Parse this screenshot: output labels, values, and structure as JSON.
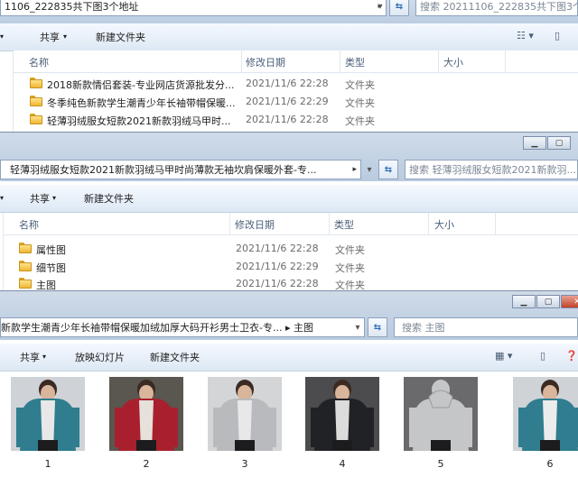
{
  "colors": {
    "accent": "#1e57a4",
    "folder": "#f0b735",
    "titlebar": "#c4d4e7"
  },
  "win1": {
    "address": "1106_222835共下图3个地址",
    "search_placeholder": "搜索 20211106_222835共下图3个地址",
    "toolbar": {
      "share": "共享",
      "new_folder": "新建文件夹"
    },
    "columns": [
      "名称",
      "修改日期",
      "类型",
      "大小"
    ],
    "rows": [
      {
        "name": "2018新款情侣套装-专业网店货源批发分...",
        "date": "2021/11/6 22:28",
        "type": "文件夹"
      },
      {
        "name": "冬季纯色新款学生潮青少年长袖带帽保暖...",
        "date": "2021/11/6 22:29",
        "type": "文件夹"
      },
      {
        "name": "轻薄羽绒服女短款2021新款羽绒马甲时...",
        "date": "2021/11/6 22:28",
        "type": "文件夹"
      }
    ]
  },
  "win2": {
    "address": "轻薄羽绒服女短款2021新款羽绒马甲时尚薄款无袖坎肩保暖外套-专...",
    "search_placeholder": "搜索 轻薄羽绒服女短款2021新款羽...",
    "toolbar": {
      "share": "共享",
      "new_folder": "新建文件夹"
    },
    "columns": [
      "名称",
      "修改日期",
      "类型",
      "大小"
    ],
    "rows": [
      {
        "name": "属性图",
        "date": "2021/11/6 22:28",
        "type": "文件夹"
      },
      {
        "name": "细节图",
        "date": "2021/11/6 22:29",
        "type": "文件夹"
      },
      {
        "name": "主图",
        "date": "2021/11/6 22:28",
        "type": "文件夹"
      }
    ]
  },
  "win3": {
    "address": "新款学生潮青少年长袖带帽保暖加绒加厚大码开衫男士卫衣-专...  ▸  主图",
    "search_placeholder": "搜索 主图",
    "toolbar": {
      "share": "共享",
      "slideshow": "放映幻灯片",
      "new_folder": "新建文件夹"
    },
    "thumbnails": [
      {
        "label": "1",
        "jacket": "#2f7d8f",
        "shirt": "#e8e8e8",
        "bg": "#cfd2d6"
      },
      {
        "label": "2",
        "jacket": "#a8202e",
        "shirt": "#e6e1da",
        "bg": "#5a5650"
      },
      {
        "label": "3",
        "jacket": "#b9babd",
        "shirt": "#e8e8e8",
        "bg": "#d4d5d7"
      },
      {
        "label": "4",
        "jacket": "#202226",
        "shirt": "#dcdcdc",
        "bg": "#4c4c4e"
      },
      {
        "label": "5",
        "jacket": "#c5c6c8",
        "shirt": "#c5c6c8",
        "bg": "#6a6a6c"
      },
      {
        "label": "6",
        "jacket": "#2f7d8f",
        "shirt": "#ececec",
        "bg": "#cfd2d6"
      }
    ]
  }
}
